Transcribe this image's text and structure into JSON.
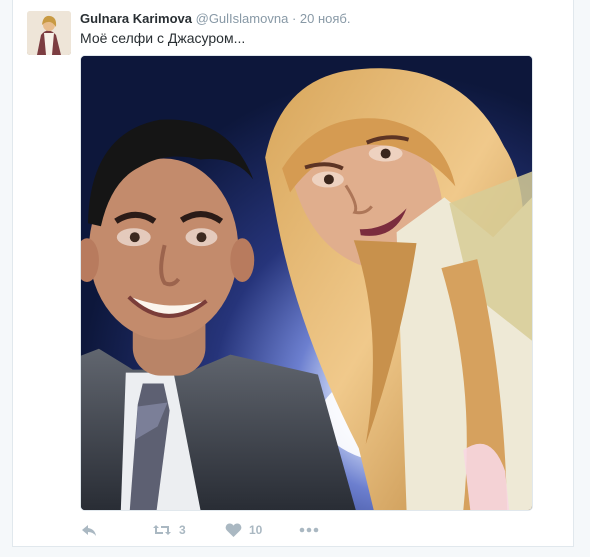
{
  "tweet": {
    "author": {
      "fullname": "Gulnara Karimova",
      "username": "@GulIslamovna",
      "avatar_icon": "profile-avatar"
    },
    "separator": "·",
    "timestamp": "20 нояб.",
    "text": "Моё селфи с Джасуром...",
    "media": {
      "type": "photo",
      "description_icon": "selfie-photo"
    },
    "actions": {
      "reply": {
        "icon": "reply-icon",
        "count": ""
      },
      "retweet": {
        "icon": "retweet-icon",
        "count": "3"
      },
      "like": {
        "icon": "heart-icon",
        "count": "10"
      },
      "more": {
        "icon": "more-icon",
        "count": ""
      }
    }
  },
  "colors": {
    "page_background": "#f5f8fa",
    "card_background": "#ffffff",
    "border": "#e1e8ed",
    "primary_text": "#292f33",
    "secondary_text": "#8899a6",
    "action_gray": "#aab8c2"
  }
}
